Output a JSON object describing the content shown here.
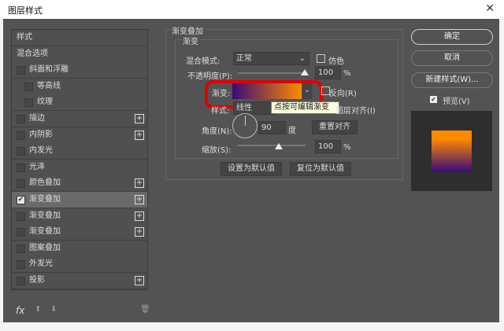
{
  "window": {
    "title": "图层样式",
    "close": "✕"
  },
  "sidebar": {
    "items": [
      {
        "label": "样式",
        "checkbox": false,
        "plus": false
      },
      {
        "label": "混合选项",
        "checkbox": false,
        "plus": false
      },
      {
        "label": "斜面和浮雕",
        "checkbox": true,
        "checked": false,
        "plus": false
      },
      {
        "label": "等高线",
        "checkbox": true,
        "checked": false,
        "plus": false,
        "indent": true
      },
      {
        "label": "纹理",
        "checkbox": true,
        "checked": false,
        "plus": false,
        "indent": true
      },
      {
        "label": "描边",
        "checkbox": true,
        "checked": false,
        "plus": true
      },
      {
        "label": "内阴影",
        "checkbox": true,
        "checked": false,
        "plus": true
      },
      {
        "label": "内发光",
        "checkbox": true,
        "checked": false,
        "plus": false
      },
      {
        "label": "光泽",
        "checkbox": true,
        "checked": false,
        "plus": false
      },
      {
        "label": "颜色叠加",
        "checkbox": true,
        "checked": false,
        "plus": true
      },
      {
        "label": "渐变叠加",
        "checkbox": true,
        "checked": true,
        "plus": true,
        "selected": true
      },
      {
        "label": "渐变叠加",
        "checkbox": true,
        "checked": false,
        "plus": true
      },
      {
        "label": "渐变叠加",
        "checkbox": true,
        "checked": false,
        "plus": true
      },
      {
        "label": "图案叠加",
        "checkbox": true,
        "checked": false,
        "plus": false
      },
      {
        "label": "外发光",
        "checkbox": true,
        "checked": false,
        "plus": false
      },
      {
        "label": "投影",
        "checkbox": true,
        "checked": false,
        "plus": true
      }
    ],
    "fx": "fx"
  },
  "panel": {
    "group_title": "渐变叠加",
    "sub_title": "渐变",
    "blend_mode_label": "混合模式:",
    "blend_mode": "正常",
    "dither_label": "仿色",
    "opacity_label": "不透明度(P):",
    "opacity": "100",
    "opacity_pct": 0.97,
    "percent": "%",
    "gradient_label": "渐变:",
    "gradient_colors": [
      "#3a0a78",
      "#ff8a00"
    ],
    "reverse_label": "反向(R)",
    "style_label": "样式:",
    "style": "线性",
    "tooltip": "点按可编辑渐变",
    "align_label": "图层对齐(I)",
    "angle_label": "角度(N):",
    "angle": "90",
    "degree": "度",
    "reset_align": "重置对齐",
    "scale_label": "缩放(S):",
    "scale": "100",
    "scale_pct": 0.6,
    "set_default": "设置为默认值",
    "reset_default": "复位为默认值"
  },
  "right": {
    "ok": "确定",
    "cancel": "取消",
    "new_style": "新建样式(W)...",
    "preview_label": "预览(V)",
    "preview_checked": true,
    "highlight_color": "#e00000"
  }
}
